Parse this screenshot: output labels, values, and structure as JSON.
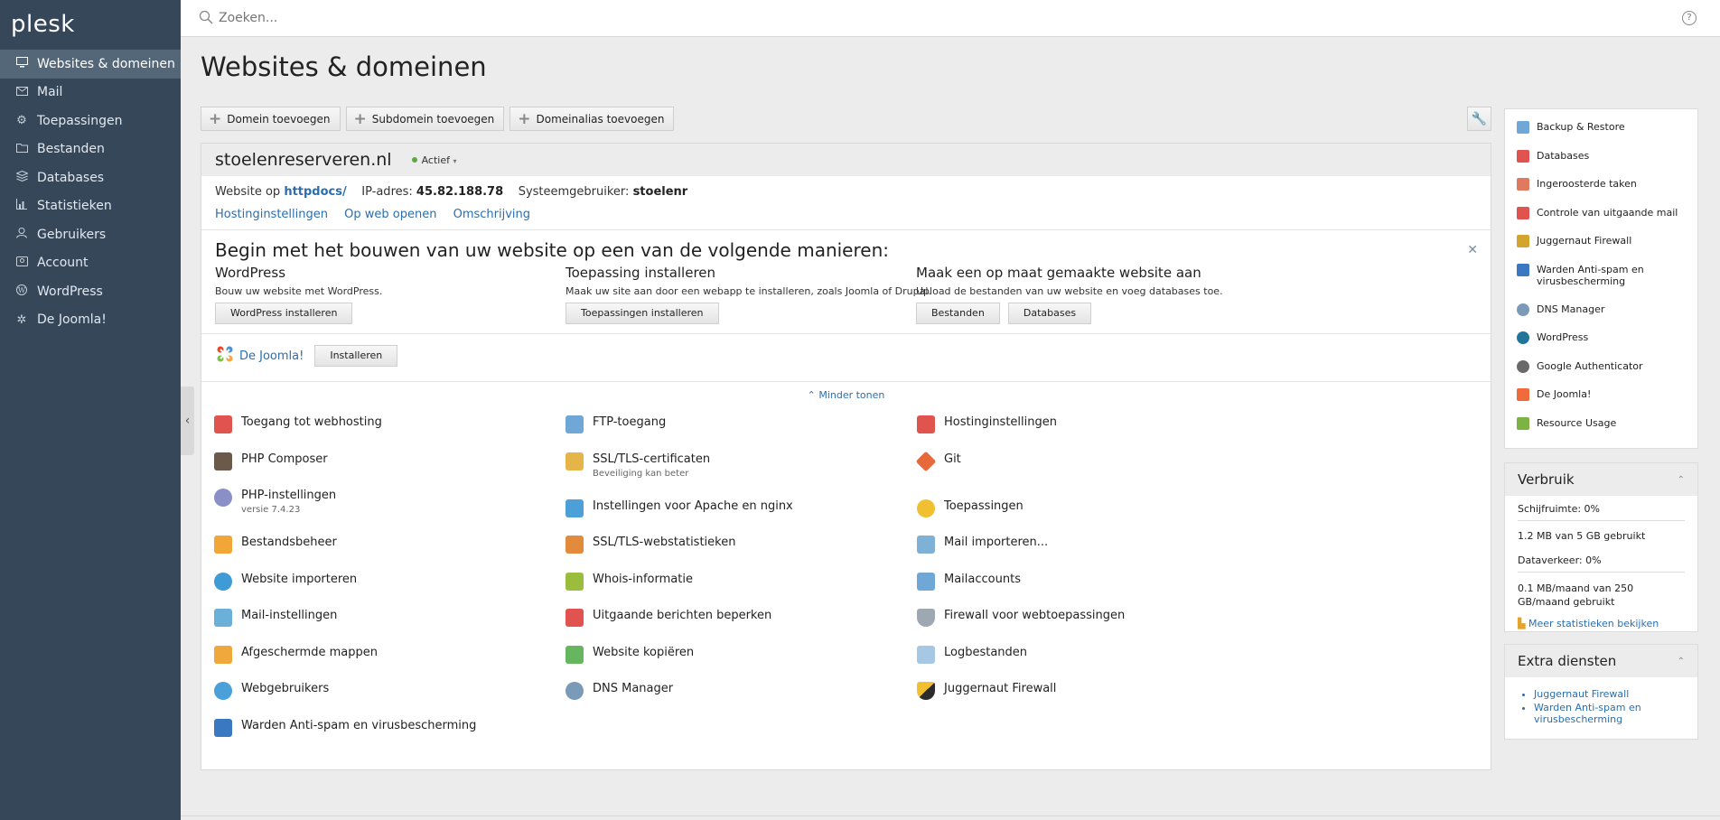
{
  "app": {
    "logo": "plesk"
  },
  "search": {
    "placeholder": "Zoeken..."
  },
  "sidebar": {
    "items": [
      {
        "label": "Websites & domeinen",
        "icon": "monitor-icon",
        "active": true
      },
      {
        "label": "Mail",
        "icon": "envelope-icon"
      },
      {
        "label": "Toepassingen",
        "icon": "gear-icon"
      },
      {
        "label": "Bestanden",
        "icon": "folder-icon"
      },
      {
        "label": "Databases",
        "icon": "database-icon"
      },
      {
        "label": "Statistieken",
        "icon": "bar-chart-icon"
      },
      {
        "label": "Gebruikers",
        "icon": "user-icon"
      },
      {
        "label": "Account",
        "icon": "account-icon"
      },
      {
        "label": "WordPress",
        "icon": "wordpress-icon"
      },
      {
        "label": "De Joomla!",
        "icon": "joomla-icon"
      }
    ]
  },
  "page": {
    "title": "Websites & domeinen"
  },
  "toolbar": {
    "add_domain": "Domein toevoegen",
    "add_subdomain": "Subdomein toevoegen",
    "add_alias": "Domeinalias toevoegen"
  },
  "domain": {
    "name": "stoelenreserveren.nl",
    "status": "Actief",
    "website_label": "Website op",
    "website_path": "httpdocs/",
    "ip_label": "IP-adres:",
    "ip": "45.82.188.78",
    "user_label": "Systeemgebruiker:",
    "user": "stoelenr",
    "links": [
      "Hostinginstellingen",
      "Op web openen",
      "Omschrijving"
    ]
  },
  "build": {
    "title": "Begin met het bouwen van uw website op een van de volgende manieren:",
    "options": [
      {
        "title": "WordPress",
        "desc": "Bouw uw website met WordPress.",
        "buttons": [
          "WordPress installeren"
        ]
      },
      {
        "title": "Toepassing installeren",
        "desc": "Maak uw site aan door een webapp te installeren, zoals Joomla of Drupal.",
        "buttons": [
          "Toepassingen installeren"
        ]
      },
      {
        "title": "Maak een op maat gemaakte website aan",
        "desc": "Upload de bestanden van uw website en voeg databases toe.",
        "buttons": [
          "Bestanden",
          "Databases"
        ]
      }
    ],
    "joomla_link": "De Joomla!",
    "joomla_button": "Installeren",
    "show_less": "Minder tonen"
  },
  "tools": {
    "col1": [
      {
        "label": "Toegang tot webhosting",
        "color": "#e0534f"
      },
      {
        "label": "PHP Composer",
        "color": "#6b5a4a"
      },
      {
        "label": "PHP-instellingen",
        "sub": "versie 7.4.23",
        "color": "#8a8fc7"
      },
      {
        "label": "Bestandsbeheer",
        "color": "#f3a638"
      },
      {
        "label": "Website importeren",
        "color": "#3e9bd6"
      },
      {
        "label": "Mail-instellingen",
        "color": "#6bb0d8"
      },
      {
        "label": "Afgeschermde mappen",
        "color": "#f0a73b"
      },
      {
        "label": "Webgebruikers",
        "color": "#4aa0d8"
      },
      {
        "label": "Warden Anti-spam en virusbescherming",
        "color": "#3a78c2"
      }
    ],
    "col2": [
      {
        "label": "FTP-toegang",
        "color": "#6fa8d6"
      },
      {
        "label": "SSL/TLS-certificaten",
        "sub": "Beveiliging kan beter",
        "color": "#e6b54a"
      },
      {
        "label": "Instellingen voor Apache en nginx",
        "color": "#4d9fd8"
      },
      {
        "label": "SSL/TLS-webstatistieken",
        "color": "#e38b3c"
      },
      {
        "label": "Whois-informatie",
        "color": "#9bbd3e"
      },
      {
        "label": "Uitgaande berichten beperken",
        "color": "#e0534f"
      },
      {
        "label": "Website kopiëren",
        "color": "#65b65e"
      },
      {
        "label": "DNS Manager",
        "color": "#7a9ab8"
      }
    ],
    "col3": [
      {
        "label": "Hostinginstellingen",
        "color": "#e0534f"
      },
      {
        "label": "Git",
        "color": "#e7693a"
      },
      {
        "label": "Toepassingen",
        "color": "#f0c030"
      },
      {
        "label": "Mail importeren...",
        "color": "#7fb0d6"
      },
      {
        "label": "Mailaccounts",
        "color": "#6fa8d6"
      },
      {
        "label": "Firewall voor webtoepassingen",
        "color": "#9da8b3"
      },
      {
        "label": "Logbestanden",
        "color": "#a7c8e4"
      },
      {
        "label": "Juggernaut Firewall",
        "color": "#2c2c2c"
      }
    ]
  },
  "right_tools": [
    {
      "label": "Backup & Restore",
      "color": "#6fa8d6"
    },
    {
      "label": "Databases",
      "color": "#e0534f"
    },
    {
      "label": "Ingeroosterde taken",
      "color": "#e07a5f"
    },
    {
      "label": "Controle van uitgaande mail",
      "color": "#e0534f"
    },
    {
      "label": "Juggernaut Firewall",
      "color": "#d4a52c"
    },
    {
      "label": "Warden Anti-spam en virusbescherming",
      "color": "#3a78c2"
    },
    {
      "label": "DNS Manager",
      "color": "#7a9ab8"
    },
    {
      "label": "WordPress",
      "color": "#21759b"
    },
    {
      "label": "Google Authenticator",
      "color": "#6a6a6a"
    },
    {
      "label": "De Joomla!",
      "color": "#f06a3b"
    },
    {
      "label": "Resource Usage",
      "color": "#7cb342"
    }
  ],
  "usage": {
    "title": "Verbruik",
    "disk_label": "Schijfruimte: 0%",
    "disk_value": "1.2 MB van 5 GB gebruikt",
    "disk_pct": 0,
    "traffic_label": "Dataverkeer: 0%",
    "traffic_value": "0.1 MB/maand van 250 GB/maand gebruikt",
    "traffic_pct": 0,
    "more": "Meer statistieken bekijken"
  },
  "extra": {
    "title": "Extra diensten",
    "items": [
      "Juggernaut Firewall",
      "Warden Anti-spam en virusbescherming"
    ]
  },
  "colors": {
    "sidebar": "#36475a",
    "sidebar_active": "#546779",
    "link": "#2b6eae",
    "status": "#5aa83e"
  }
}
